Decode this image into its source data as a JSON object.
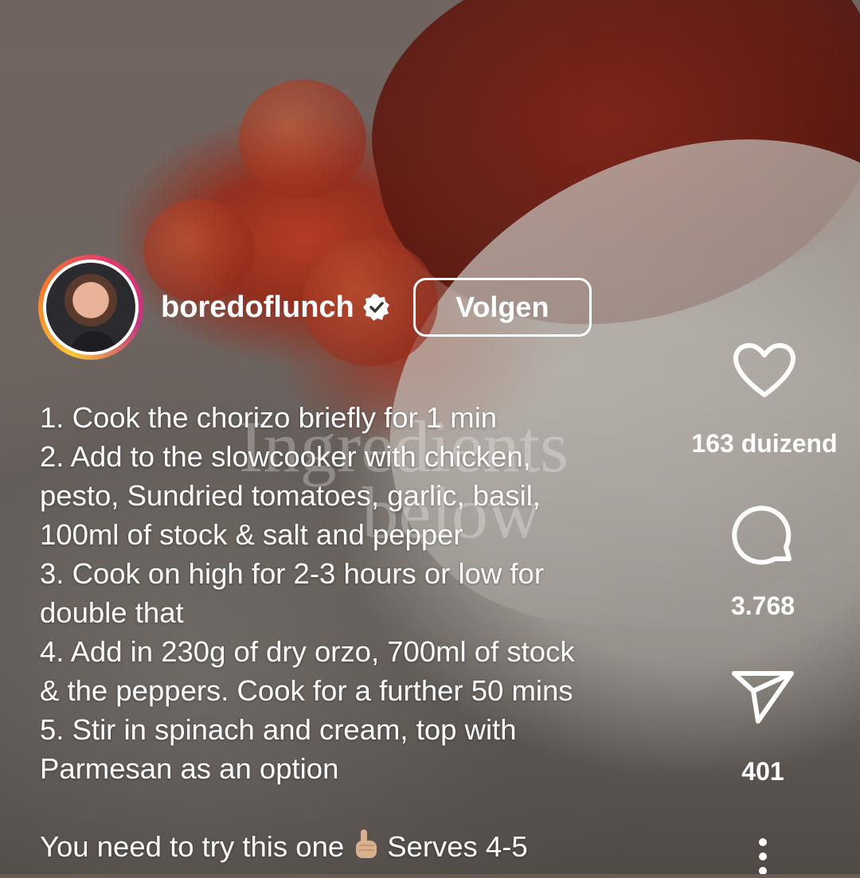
{
  "post": {
    "username": "boredoflunch",
    "follow_label": "Volgen",
    "overlay_text_line1": "Ingredients",
    "overlay_text_line2": "below"
  },
  "caption": {
    "lines": [
      "1. Cook the chorizo briefly for 1 min",
      "2. Add to the slowcooker with chicken,",
      "pesto, Sundried tomatoes, garlic, basil,",
      "100ml of stock & salt and pepper",
      "3. Cook on high for 2-3 hours or low for",
      "double that",
      "4. Add in 230g of dry orzo, 700ml of stock",
      "& the peppers. Cook for a further 50 mins",
      "5. Stir in spinach and cream, top with",
      "Parmesan as an option"
    ],
    "last_line_start": "You need to try this one",
    "last_line_end": "Serves 4-5"
  },
  "actions": {
    "likes": "163 duizend",
    "comments": "3.768",
    "shares": "401"
  },
  "icons": [
    "verified-badge-icon",
    "heart-icon",
    "comment-icon",
    "share-icon",
    "more-options-icon",
    "pointing-up-hand-emoji"
  ],
  "colors": {
    "text": "#ffffff",
    "ring_start": "#f9c53a",
    "ring_end": "#c13584"
  }
}
